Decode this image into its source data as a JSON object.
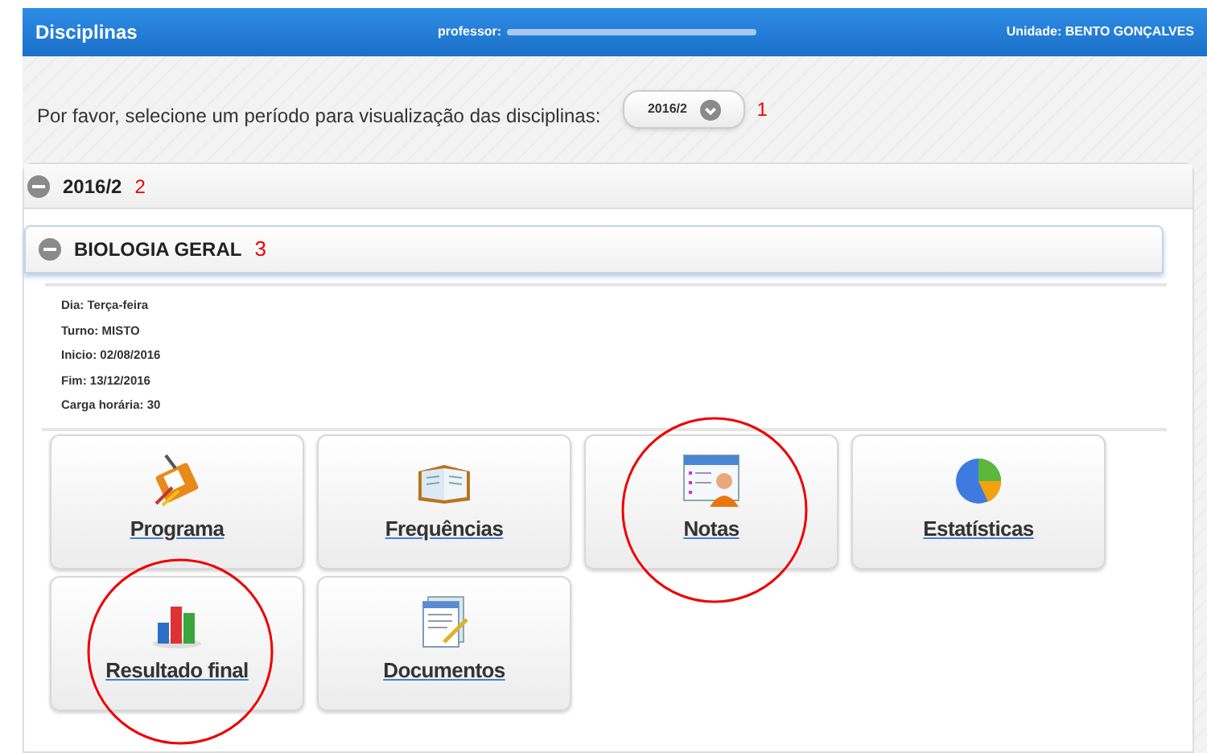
{
  "header": {
    "title": "Disciplinas",
    "professor_label": "professor:",
    "unit": "Unidade: BENTO GONÇALVES"
  },
  "period_selector": {
    "prompt": "Por favor, selecione um período para visualização das disciplinas:",
    "value": "2016/2",
    "annotation": "1"
  },
  "period": {
    "title": "2016/2",
    "expanded": true,
    "annotation": "2"
  },
  "course": {
    "title": "BIOLOGIA GERAL",
    "expanded": true,
    "annotation": "3",
    "details": [
      "Dia: Terça-feira",
      "Turno: MISTO",
      "Inicio: 02/08/2016",
      "Fim: 13/12/2016",
      "Carga horária: 30"
    ],
    "tiles": [
      {
        "kind": "program",
        "label": "Programa",
        "circled": false
      },
      {
        "kind": "attendance",
        "label": "Frequências",
        "circled": false
      },
      {
        "kind": "grades",
        "label": "Notas",
        "circled": true
      },
      {
        "kind": "stats",
        "label": "Estatísticas",
        "circled": false
      },
      {
        "kind": "results",
        "label": "Resultado final",
        "circled": true
      },
      {
        "kind": "documents",
        "label": "Documentos",
        "circled": false
      }
    ]
  }
}
